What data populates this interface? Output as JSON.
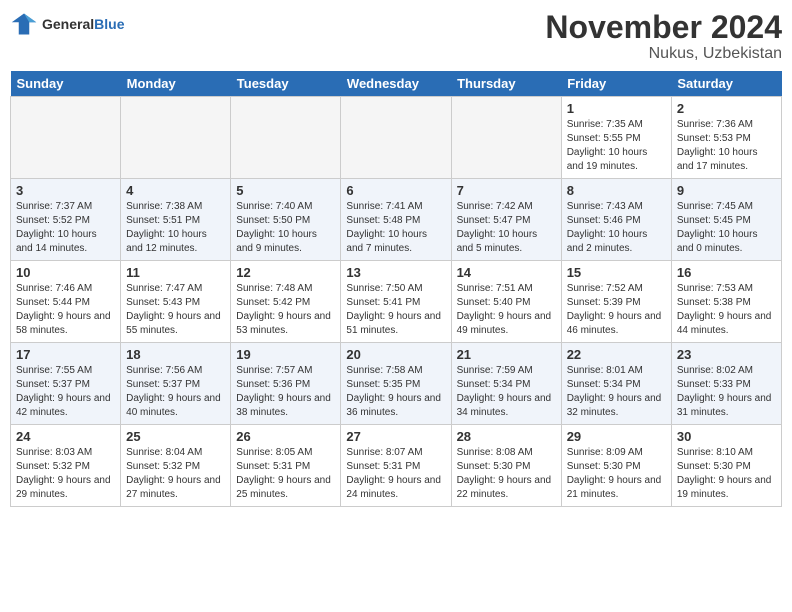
{
  "header": {
    "logo_general": "General",
    "logo_blue": "Blue",
    "month_title": "November 2024",
    "location": "Nukus, Uzbekistan"
  },
  "weekdays": [
    "Sunday",
    "Monday",
    "Tuesday",
    "Wednesday",
    "Thursday",
    "Friday",
    "Saturday"
  ],
  "weeks": [
    [
      {
        "day": "",
        "info": ""
      },
      {
        "day": "",
        "info": ""
      },
      {
        "day": "",
        "info": ""
      },
      {
        "day": "",
        "info": ""
      },
      {
        "day": "",
        "info": ""
      },
      {
        "day": "1",
        "info": "Sunrise: 7:35 AM\nSunset: 5:55 PM\nDaylight: 10 hours and 19 minutes."
      },
      {
        "day": "2",
        "info": "Sunrise: 7:36 AM\nSunset: 5:53 PM\nDaylight: 10 hours and 17 minutes."
      }
    ],
    [
      {
        "day": "3",
        "info": "Sunrise: 7:37 AM\nSunset: 5:52 PM\nDaylight: 10 hours and 14 minutes."
      },
      {
        "day": "4",
        "info": "Sunrise: 7:38 AM\nSunset: 5:51 PM\nDaylight: 10 hours and 12 minutes."
      },
      {
        "day": "5",
        "info": "Sunrise: 7:40 AM\nSunset: 5:50 PM\nDaylight: 10 hours and 9 minutes."
      },
      {
        "day": "6",
        "info": "Sunrise: 7:41 AM\nSunset: 5:48 PM\nDaylight: 10 hours and 7 minutes."
      },
      {
        "day": "7",
        "info": "Sunrise: 7:42 AM\nSunset: 5:47 PM\nDaylight: 10 hours and 5 minutes."
      },
      {
        "day": "8",
        "info": "Sunrise: 7:43 AM\nSunset: 5:46 PM\nDaylight: 10 hours and 2 minutes."
      },
      {
        "day": "9",
        "info": "Sunrise: 7:45 AM\nSunset: 5:45 PM\nDaylight: 10 hours and 0 minutes."
      }
    ],
    [
      {
        "day": "10",
        "info": "Sunrise: 7:46 AM\nSunset: 5:44 PM\nDaylight: 9 hours and 58 minutes."
      },
      {
        "day": "11",
        "info": "Sunrise: 7:47 AM\nSunset: 5:43 PM\nDaylight: 9 hours and 55 minutes."
      },
      {
        "day": "12",
        "info": "Sunrise: 7:48 AM\nSunset: 5:42 PM\nDaylight: 9 hours and 53 minutes."
      },
      {
        "day": "13",
        "info": "Sunrise: 7:50 AM\nSunset: 5:41 PM\nDaylight: 9 hours and 51 minutes."
      },
      {
        "day": "14",
        "info": "Sunrise: 7:51 AM\nSunset: 5:40 PM\nDaylight: 9 hours and 49 minutes."
      },
      {
        "day": "15",
        "info": "Sunrise: 7:52 AM\nSunset: 5:39 PM\nDaylight: 9 hours and 46 minutes."
      },
      {
        "day": "16",
        "info": "Sunrise: 7:53 AM\nSunset: 5:38 PM\nDaylight: 9 hours and 44 minutes."
      }
    ],
    [
      {
        "day": "17",
        "info": "Sunrise: 7:55 AM\nSunset: 5:37 PM\nDaylight: 9 hours and 42 minutes."
      },
      {
        "day": "18",
        "info": "Sunrise: 7:56 AM\nSunset: 5:37 PM\nDaylight: 9 hours and 40 minutes."
      },
      {
        "day": "19",
        "info": "Sunrise: 7:57 AM\nSunset: 5:36 PM\nDaylight: 9 hours and 38 minutes."
      },
      {
        "day": "20",
        "info": "Sunrise: 7:58 AM\nSunset: 5:35 PM\nDaylight: 9 hours and 36 minutes."
      },
      {
        "day": "21",
        "info": "Sunrise: 7:59 AM\nSunset: 5:34 PM\nDaylight: 9 hours and 34 minutes."
      },
      {
        "day": "22",
        "info": "Sunrise: 8:01 AM\nSunset: 5:34 PM\nDaylight: 9 hours and 32 minutes."
      },
      {
        "day": "23",
        "info": "Sunrise: 8:02 AM\nSunset: 5:33 PM\nDaylight: 9 hours and 31 minutes."
      }
    ],
    [
      {
        "day": "24",
        "info": "Sunrise: 8:03 AM\nSunset: 5:32 PM\nDaylight: 9 hours and 29 minutes."
      },
      {
        "day": "25",
        "info": "Sunrise: 8:04 AM\nSunset: 5:32 PM\nDaylight: 9 hours and 27 minutes."
      },
      {
        "day": "26",
        "info": "Sunrise: 8:05 AM\nSunset: 5:31 PM\nDaylight: 9 hours and 25 minutes."
      },
      {
        "day": "27",
        "info": "Sunrise: 8:07 AM\nSunset: 5:31 PM\nDaylight: 9 hours and 24 minutes."
      },
      {
        "day": "28",
        "info": "Sunrise: 8:08 AM\nSunset: 5:30 PM\nDaylight: 9 hours and 22 minutes."
      },
      {
        "day": "29",
        "info": "Sunrise: 8:09 AM\nSunset: 5:30 PM\nDaylight: 9 hours and 21 minutes."
      },
      {
        "day": "30",
        "info": "Sunrise: 8:10 AM\nSunset: 5:30 PM\nDaylight: 9 hours and 19 minutes."
      }
    ]
  ]
}
